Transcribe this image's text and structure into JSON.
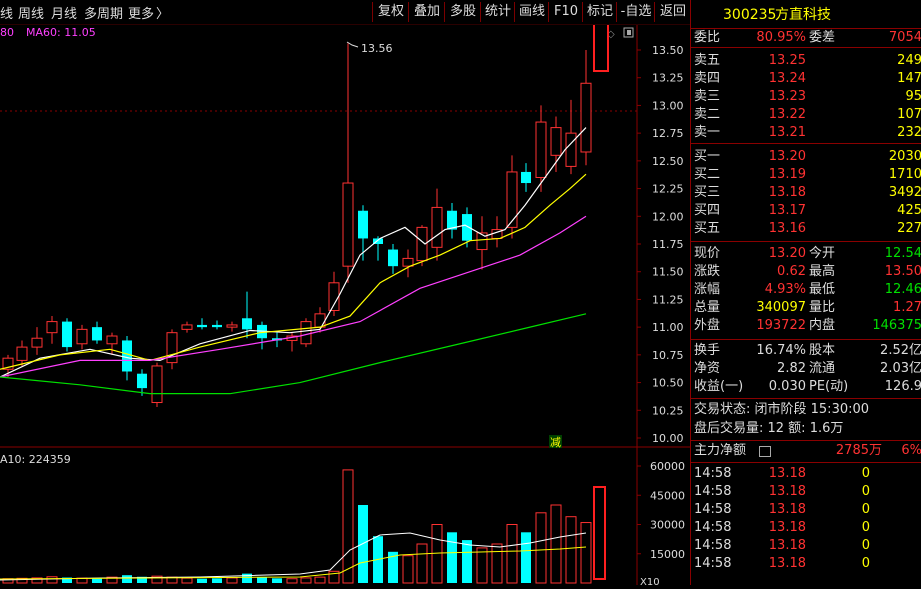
{
  "toolbar": {
    "left_items": [
      "线",
      "周线",
      "月线",
      "多周期",
      "更多"
    ],
    "more_arrow": "〉",
    "buttons": [
      "复权",
      "叠加",
      "多股",
      "统计",
      "画线",
      "F10",
      "标记",
      "-自选",
      "返回"
    ]
  },
  "main_chart": {
    "legend_prefix": "80",
    "legend_ma60": "MA60: 11.05",
    "price_axis": [
      "13.50",
      "13.25",
      "13.00",
      "12.75",
      "12.50",
      "12.25",
      "12.00",
      "11.75",
      "11.50",
      "11.25",
      "11.00",
      "10.75",
      "10.50",
      "10.25",
      "10.00"
    ],
    "high_marker": "13.56",
    "badge": "减",
    "colors": {
      "up": "#ff3232",
      "down": "#00ffff",
      "ma5": "#ffffff",
      "ma10": "#ffff00",
      "ma20": "#ff40ff",
      "ma60": "#00e000"
    }
  },
  "volume_chart": {
    "legend": "A10: 224359",
    "axis": [
      "60000",
      "45000",
      "30000",
      "15000"
    ],
    "axis_bottom": "X10"
  },
  "quote": {
    "code": "300235",
    "name": "方直科技",
    "weibi_label": "委比",
    "weibi": "80.95%",
    "weicha_label": "委差",
    "weicha": "7054",
    "asks": [
      {
        "label": "卖五",
        "price": "13.25",
        "vol": "249"
      },
      {
        "label": "卖四",
        "price": "13.24",
        "vol": "147"
      },
      {
        "label": "卖三",
        "price": "13.23",
        "vol": "95"
      },
      {
        "label": "卖二",
        "price": "13.22",
        "vol": "107"
      },
      {
        "label": "卖一",
        "price": "13.21",
        "vol": "232"
      }
    ],
    "bids": [
      {
        "label": "买一",
        "price": "13.20",
        "vol": "2030"
      },
      {
        "label": "买二",
        "price": "13.19",
        "vol": "1710"
      },
      {
        "label": "买三",
        "price": "13.18",
        "vol": "3492"
      },
      {
        "label": "买四",
        "price": "13.17",
        "vol": "425"
      },
      {
        "label": "买五",
        "price": "13.16",
        "vol": "227"
      }
    ],
    "stats": [
      {
        "l1": "现价",
        "v1": "13.20",
        "c1": "red",
        "l2": "今开",
        "v2": "12.54",
        "c2": "green"
      },
      {
        "l1": "涨跌",
        "v1": "0.62",
        "c1": "red",
        "l2": "最高",
        "v2": "13.50",
        "c2": "red"
      },
      {
        "l1": "涨幅",
        "v1": "4.93%",
        "c1": "red",
        "l2": "最低",
        "v2": "12.46",
        "c2": "green"
      },
      {
        "l1": "总量",
        "v1": "340097",
        "c1": "yellow",
        "l2": "量比",
        "v2": "1.27",
        "c2": "red"
      },
      {
        "l1": "外盘",
        "v1": "193722",
        "c1": "red",
        "l2": "内盘",
        "v2": "146375",
        "c2": "green"
      }
    ],
    "stats2": [
      {
        "l1": "换手",
        "v1": "16.74%",
        "l2": "股本",
        "v2": "2.52亿"
      },
      {
        "l1": "净资",
        "v1": "2.82",
        "l2": "流通",
        "v2": "2.03亿"
      },
      {
        "l1": "收益(一)",
        "v1": "0.030",
        "l2": "PE(动)",
        "v2": "126.9"
      }
    ],
    "trade_status": "交易状态: 闭市阶段  15:30:00",
    "after_hours": "盘后交易量: 12  额: 1.6万",
    "main_flow_label": "主力净额",
    "main_flow_value": "2785万",
    "main_flow_pct": "6%",
    "ticks": [
      {
        "time": "14:58",
        "price": "13.18",
        "vol": "0"
      },
      {
        "time": "14:58",
        "price": "13.18",
        "vol": "0"
      },
      {
        "time": "14:58",
        "price": "13.18",
        "vol": "0"
      },
      {
        "time": "14:58",
        "price": "13.18",
        "vol": "0"
      },
      {
        "time": "14:58",
        "price": "13.18",
        "vol": "0"
      },
      {
        "time": "14:58",
        "price": "13.18",
        "vol": "0"
      }
    ]
  }
}
